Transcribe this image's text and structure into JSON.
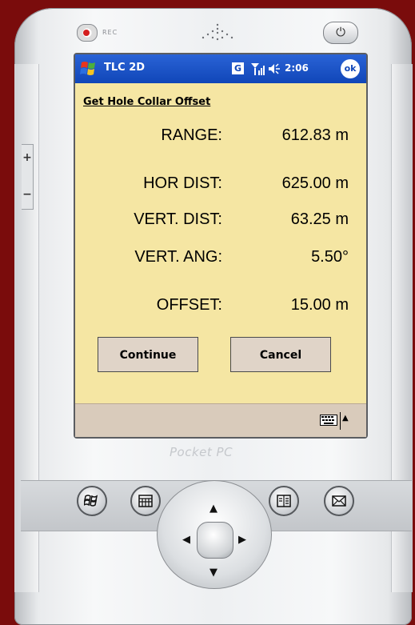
{
  "device": {
    "rec_label": "REC",
    "power_icon": "power-icon",
    "brand": "Pocket PC",
    "hardware_buttons": [
      "windows-button-icon",
      "calendar-button-icon",
      "contacts-button-icon",
      "inbox-button-icon"
    ]
  },
  "titlebar": {
    "app_title": "TLC 2D",
    "g_badge": "G",
    "clock": "2:06",
    "ok_label": "ok",
    "colors": {
      "bar": "#1046b8",
      "text": "#ffffff"
    }
  },
  "form": {
    "heading": "Get Hole Collar Offset",
    "rows": [
      {
        "label": "RANGE:",
        "value": "612.83 m"
      },
      {
        "label": "HOR DIST:",
        "value": "625.00 m"
      },
      {
        "label": "VERT. DIST:",
        "value": "63.25 m"
      },
      {
        "label": "VERT. ANG:",
        "value": "5.50°"
      },
      {
        "label": "OFFSET:",
        "value": "15.00 m"
      }
    ],
    "continue_label": "Continue",
    "cancel_label": "Cancel",
    "colors": {
      "background": "#f5e6a3",
      "button": "#e0d4c8",
      "menubar": "#d9cbbb"
    }
  },
  "menubar": {
    "keyboard_icon": "keyboard-icon",
    "arrow": "▲"
  }
}
